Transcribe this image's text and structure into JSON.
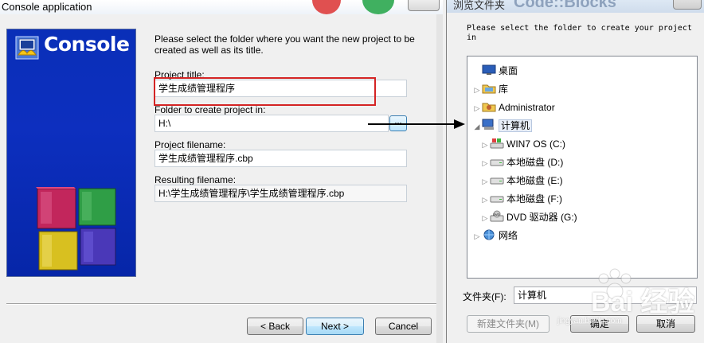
{
  "wizard": {
    "title": "Console application",
    "banner_title": "Console",
    "intro": "Please select the folder where you want the new project to be created as well as its title.",
    "project_title_label": "Project title:",
    "project_title_value": "学生成绩管理程序",
    "folder_label": "Folder to create project in:",
    "folder_value": "H:\\",
    "browse_label": "...",
    "project_filename_label": "Project filename:",
    "project_filename_value": "学生成绩管理程序.cbp",
    "resulting_filename_label": "Resulting filename:",
    "resulting_filename_value": "H:\\学生成绩管理程序\\学生成绩管理程序.cbp",
    "back_label": "< Back",
    "next_label": "Next >",
    "cancel_label": "Cancel",
    "highlight_color": "#d42424"
  },
  "dialog": {
    "title": "浏览文件夹",
    "background_text": "Code::Blocks",
    "prompt": "Please select the folder to create your project in",
    "tree": [
      {
        "label": "桌面",
        "icon": "desktop-icon",
        "level": 0,
        "expander": ""
      },
      {
        "label": "库",
        "icon": "library-icon",
        "level": 1,
        "expander": "▷"
      },
      {
        "label": "Administrator",
        "icon": "user-folder-icon",
        "level": 1,
        "expander": "▷"
      },
      {
        "label": "计算机",
        "icon": "computer-icon",
        "level": 1,
        "expander": "◢",
        "selected": true
      },
      {
        "label": "WIN7 OS (C:)",
        "icon": "system-drive-icon",
        "level": 2,
        "expander": "▷"
      },
      {
        "label": "本地磁盘 (D:)",
        "icon": "drive-icon",
        "level": 2,
        "expander": "▷"
      },
      {
        "label": "本地磁盘 (E:)",
        "icon": "drive-icon",
        "level": 2,
        "expander": "▷"
      },
      {
        "label": "本地磁盘 (F:)",
        "icon": "drive-icon",
        "level": 2,
        "expander": "▷"
      },
      {
        "label": "DVD 驱动器 (G:)",
        "icon": "dvd-drive-icon",
        "level": 2,
        "expander": "▷"
      },
      {
        "label": "网络",
        "icon": "network-icon",
        "level": 1,
        "expander": "▷"
      }
    ],
    "folder_label": "文件夹(F):",
    "folder_value": "计算机",
    "new_folder_label": "新建文件夹(M)",
    "ok_label": "确定",
    "cancel_label": "取消"
  },
  "watermark": {
    "text": "Bai 经验",
    "sub": "jingyan.baidu.com"
  }
}
